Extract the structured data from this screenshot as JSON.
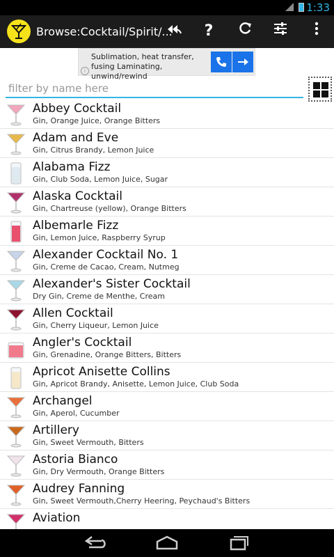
{
  "status_bar": {
    "time": "1:33",
    "signal": "3G"
  },
  "action_bar": {
    "title": "Browse:Cocktail/Spirit/...",
    "icons": [
      "back-arrows-icon",
      "help-icon",
      "refresh-icon",
      "settings-sliders-icon",
      "overflow-menu-icon"
    ]
  },
  "ad": {
    "text": "Sublimation, heat transfer, fusing Laminating, unwind/rewind",
    "info": "i"
  },
  "filter": {
    "placeholder": "filter by name here"
  },
  "cocktails": [
    {
      "name": "Abbey Cocktail",
      "ingredients": "Gin, Orange Juice, Orange Bitters",
      "color": "#f2a7bc",
      "glass": "martini"
    },
    {
      "name": "Adam and Eve",
      "ingredients": "Gin, Citrus Brandy, Lemon Juice",
      "color": "#e8b84b",
      "glass": "martini"
    },
    {
      "name": "Alabama Fizz",
      "ingredients": "Gin, Club Soda, Lemon Juice, Sugar",
      "color": "#dfe9f0",
      "glass": "tall"
    },
    {
      "name": "Alaska Cocktail",
      "ingredients": "Gin, Chartreuse (yellow), Orange Bitters",
      "color": "#b0306a",
      "glass": "martini"
    },
    {
      "name": "Albemarle Fizz",
      "ingredients": "Gin, Lemon Juice, Raspberry Syrup",
      "color": "#e8506e",
      "glass": "tall"
    },
    {
      "name": "Alexander Cocktail No. 1",
      "ingredients": "Gin, Creme de Cacao, Cream, Nutmeg",
      "color": "#c7d4ea",
      "glass": "martini"
    },
    {
      "name": "Alexander's Sister Cocktail",
      "ingredients": "Dry Gin, Creme de Menthe, Cream",
      "color": "#a9d8e8",
      "glass": "martini"
    },
    {
      "name": "Allen Cocktail",
      "ingredients": "Gin, Cherry Liqueur, Lemon Juice",
      "color": "#8e1230",
      "glass": "martini"
    },
    {
      "name": "Angler's Cocktail",
      "ingredients": "Gin, Grenadine, Orange Bitters, Bitters",
      "color": "#f07a8c",
      "glass": "rocks"
    },
    {
      "name": "Apricot Anisette Collins",
      "ingredients": "Gin, Apricot Brandy, Anisette, Lemon Juice, Club Soda",
      "color": "#f6e7c8",
      "glass": "tall"
    },
    {
      "name": "Archangel",
      "ingredients": "Gin, Aperol, Cucumber",
      "color": "#e8703a",
      "glass": "martini"
    },
    {
      "name": "Artillery",
      "ingredients": "Gin, Sweet Vermouth, Bitters",
      "color": "#c86a1e",
      "glass": "martini"
    },
    {
      "name": "Astoria Bianco",
      "ingredients": "Gin, Dry Vermouth, Orange Bitters",
      "color": "#f0e4ea",
      "glass": "martini"
    },
    {
      "name": "Audrey Fanning",
      "ingredients": "Gin, Sweet Vermouth,Cherry Heering, Peychaud's Bitters",
      "color": "#e0602a",
      "glass": "martini"
    },
    {
      "name": "Aviation",
      "ingredients": "",
      "color": "#d0306a",
      "glass": "martini"
    }
  ]
}
